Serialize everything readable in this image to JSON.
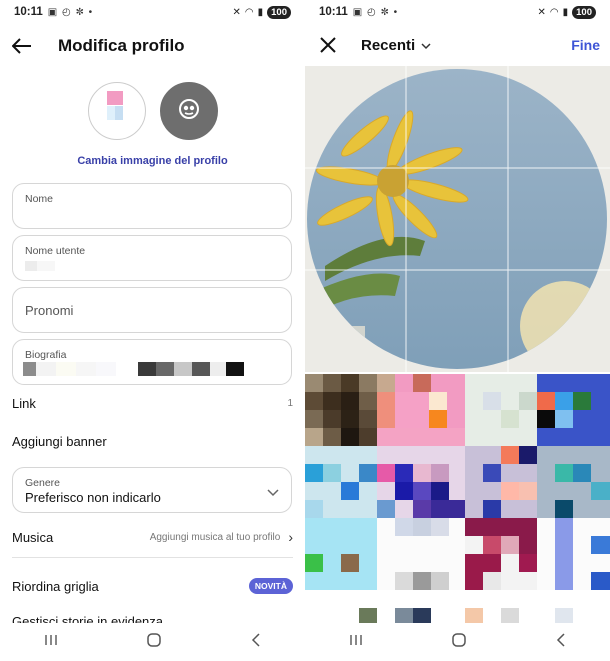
{
  "status": {
    "time": "10:11",
    "battery": "100"
  },
  "left": {
    "title": "Modifica profilo",
    "change_photo": "Cambia immagine del profilo",
    "fields": {
      "name_label": "Nome",
      "username_label": "Nome utente",
      "pronouns_placeholder": "Pronomi",
      "bio_label": "Biografia",
      "gender_label": "Genere",
      "gender_value": "Preferisco non indicarlo"
    },
    "rows": {
      "link_label": "Link",
      "link_count": "1",
      "banner_label": "Aggiungi banner",
      "music_label": "Musica",
      "music_aux": "Aggiungi musica al tuo profilo",
      "grid_label": "Riordina griglia",
      "grid_badge": "NOVITÀ",
      "highlights_label": "Gestisci storie in evidenza"
    }
  },
  "right": {
    "title": "Recenti",
    "done": "Fine"
  },
  "icons": {
    "back": "arrow-left-icon",
    "close": "close-icon",
    "chevron": "chevron-down-icon",
    "arrow_right": "chevron-right-icon",
    "avatar_placeholder": "face-icon",
    "nav": [
      "recent-apps-icon",
      "home-icon",
      "back-icon"
    ]
  },
  "colors": {
    "link_blue": "#3940a8",
    "done_blue": "#3e55d6",
    "badge_bg": "#5c63d6"
  }
}
